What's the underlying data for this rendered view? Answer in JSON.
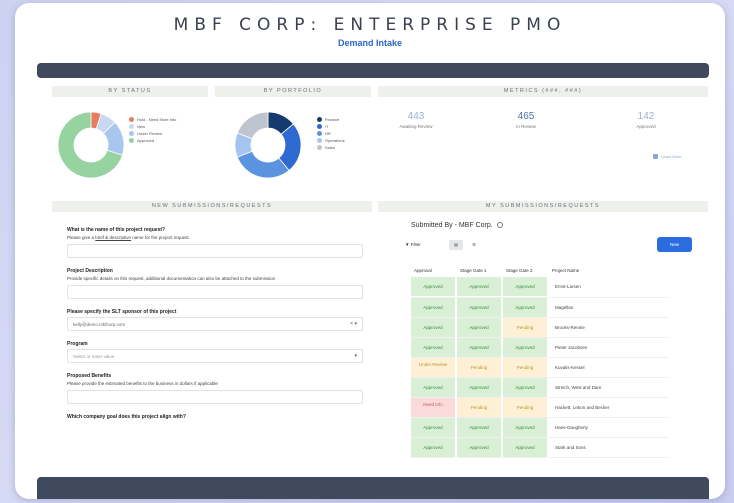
{
  "header": {
    "title": "MBF CORP: ENTERPRISE PMO",
    "subtitle": "Demand Intake"
  },
  "sections": {
    "by_status": "BY STATUS",
    "by_portfolio": "BY PORTFOLIO",
    "metrics": "METRICS (###, ###)",
    "new_submissions": "NEW SUBMISSIONS/REQUESTS",
    "my_submissions": "MY SUBMISSIONS/REQUESTS"
  },
  "status_chart": {
    "legend": [
      "Hold - Need More Info",
      "New",
      "Under Review",
      "Approved"
    ],
    "colors": [
      "#e87a5d",
      "#c8d8f0",
      "#a9c6ee",
      "#96d3a0"
    ],
    "values": [
      5,
      8,
      17,
      70
    ]
  },
  "portfolio_chart": {
    "legend": [
      "Finance",
      "IT",
      "HR",
      "Operations",
      "Sales"
    ],
    "colors": [
      "#163a6e",
      "#2f6ad3",
      "#5c93e0",
      "#a6c4ef",
      "#bfc5cf"
    ],
    "values": [
      14,
      25,
      30,
      12,
      19
    ]
  },
  "metrics": [
    {
      "value": "443",
      "label": "Awaiting Review"
    },
    {
      "value": "465",
      "label": "In Review"
    },
    {
      "value": "142",
      "label": "Approved"
    }
  ],
  "metrics_link": "Learn More",
  "form": {
    "q1": "What is the name of this project request?",
    "d1_prefix": "Please give a ",
    "d1_link": "brief & descriptive",
    "d1_suffix": " name for the project request.",
    "q2": "Project Description",
    "d2": "Provide specific details on this request, additional documentation can also be attached to the submission",
    "q3": "Please specify the SLT sponsor of this project",
    "v3": "kelly@demo.mbfcorp.com",
    "q4": "Program",
    "p4": "Select or enter value",
    "q5": "Proposed Benefits",
    "d5": "Please provide the estimated benefits to the business in dollars if applicable",
    "q6": "Which company goal does this project align with?"
  },
  "submissions": {
    "title": "Submitted By - MBF Corp.",
    "filter": "Filter",
    "new_button": "New",
    "columns": [
      "Approval",
      "Stage Gate 1",
      "Stage Gate 2",
      "Project Name"
    ],
    "rows": [
      {
        "approval": "Approved",
        "sg1": "Approved",
        "sg2": "Approved",
        "name": "Ernst-Larsen",
        "a": "approved",
        "s1": "approved",
        "s2": "approved"
      },
      {
        "approval": "Approved",
        "sg1": "Approved",
        "sg2": "Approved",
        "name": "Magellan",
        "a": "approved",
        "s1": "approved",
        "s2": "approved"
      },
      {
        "approval": "Approved",
        "sg1": "Approved",
        "sg2": "Pending",
        "name": "Brooks-Rennie",
        "a": "approved",
        "s1": "approved",
        "s2": "pending"
      },
      {
        "approval": "Approved",
        "sg1": "Approved",
        "sg2": "Approved",
        "name": "Pieter Jacobsen",
        "a": "approved",
        "s1": "approved",
        "s2": "approved"
      },
      {
        "approval": "Under Review",
        "sg1": "Pending",
        "sg2": "Pending",
        "name": "Kuvalis-Kessel",
        "a": "under",
        "s1": "pending",
        "s2": "pending"
      },
      {
        "approval": "Approved",
        "sg1": "Approved",
        "sg2": "Approved",
        "name": "Streich, West and Dare",
        "a": "approved",
        "s1": "approved",
        "s2": "approved"
      },
      {
        "approval": "Need Info",
        "sg1": "Pending",
        "sg2": "Pending",
        "name": "Hackett, Lebon and Becker",
        "a": "need",
        "s1": "pending",
        "s2": "pending"
      },
      {
        "approval": "Approved",
        "sg1": "Approved",
        "sg2": "Approved",
        "name": "Hane-Daugherty",
        "a": "approved",
        "s1": "approved",
        "s2": "approved"
      },
      {
        "approval": "Approved",
        "sg1": "Approved",
        "sg2": "Approved",
        "name": "Stark and Sons",
        "a": "approved",
        "s1": "approved",
        "s2": "approved"
      }
    ]
  }
}
